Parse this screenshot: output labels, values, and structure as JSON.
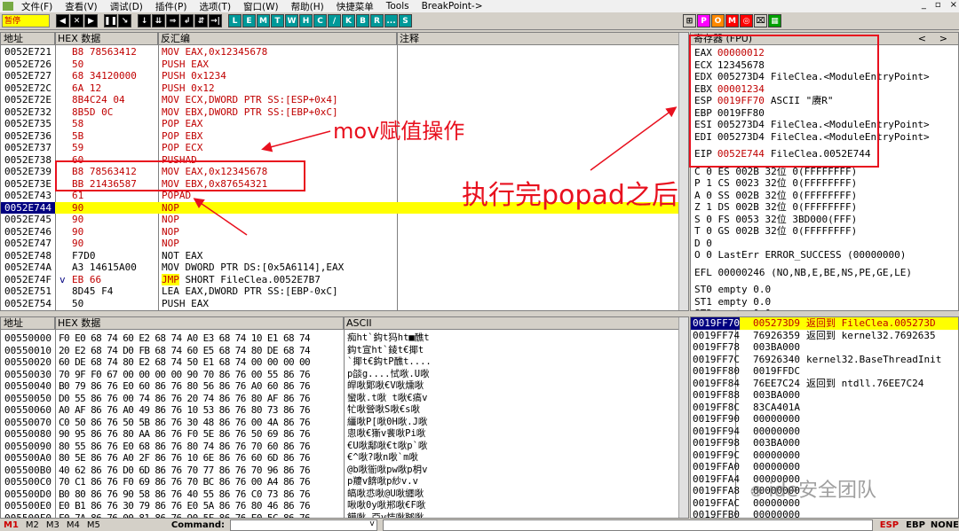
{
  "menu": {
    "items": [
      "文件(F)",
      "查看(V)",
      "调试(D)",
      "插件(P)",
      "选项(T)",
      "窗口(W)",
      "帮助(H)",
      "快捷菜单",
      "Tools",
      "BreakPoint->"
    ],
    "win_buttons": [
      "_",
      "▫",
      "×"
    ]
  },
  "toolbar": {
    "status": "暂停",
    "buttons": [
      "◀",
      "✕",
      "▶",
      "❚❚",
      "↘",
      "↓",
      "⇊",
      "⇒",
      "↲",
      "⇵",
      "→|"
    ],
    "letters": [
      "L",
      "E",
      "M",
      "T",
      "W",
      "H",
      "C",
      "/",
      "K",
      "B",
      "R",
      "...",
      "S"
    ],
    "extra": [
      "⊞",
      "P",
      "O",
      "M",
      "◎",
      "⌧",
      "▦"
    ]
  },
  "disasm": {
    "headers": [
      "地址",
      "HEX 数据",
      "反汇编",
      "注释"
    ],
    "rows": [
      {
        "addr": "0052E721",
        "hex": "B8 78563412",
        "asm": "MOV EAX,0x12345678",
        "mark": "",
        "hl": false
      },
      {
        "addr": "0052E726",
        "hex": "50",
        "asm": "PUSH EAX",
        "mark": "",
        "hl": false
      },
      {
        "addr": "0052E727",
        "hex": "68 34120000",
        "asm": "PUSH 0x1234",
        "mark": "",
        "hl": false
      },
      {
        "addr": "0052E72C",
        "hex": "6A 12",
        "asm": "PUSH 0x12",
        "mark": "",
        "hl": false
      },
      {
        "addr": "0052E72E",
        "hex": "8B4C24 04",
        "asm": "MOV ECX,DWORD PTR SS:[ESP+0x4]",
        "mark": "",
        "hl": false
      },
      {
        "addr": "0052E732",
        "hex": "8B5D 0C",
        "asm": "MOV EBX,DWORD PTR SS:[EBP+0xC]",
        "mark": "",
        "hl": false
      },
      {
        "addr": "0052E735",
        "hex": "58",
        "asm": "POP EAX",
        "mark": "",
        "hl": false
      },
      {
        "addr": "0052E736",
        "hex": "5B",
        "asm": "POP EBX",
        "mark": "",
        "hl": false
      },
      {
        "addr": "0052E737",
        "hex": "59",
        "asm": "POP ECX",
        "mark": "",
        "hl": false
      },
      {
        "addr": "0052E738",
        "hex": "60",
        "asm": "PUSHAD",
        "mark": "",
        "hl": false
      },
      {
        "addr": "0052E739",
        "hex": "B8 78563412",
        "asm": "MOV EAX,0x12345678",
        "mark": "",
        "hl": false
      },
      {
        "addr": "0052E73E",
        "hex": "BB 21436587",
        "asm": "MOV EBX,0x87654321",
        "mark": "",
        "hl": false
      },
      {
        "addr": "0052E743",
        "hex": "61",
        "asm": "POPAD",
        "mark": "",
        "hl": false
      },
      {
        "addr": "0052E744",
        "hex": "90",
        "asm": "NOP",
        "mark": "",
        "hl": true
      },
      {
        "addr": "0052E745",
        "hex": "90",
        "asm": "NOP",
        "mark": "",
        "hl": false
      },
      {
        "addr": "0052E746",
        "hex": "90",
        "asm": "NOP",
        "mark": "",
        "hl": false
      },
      {
        "addr": "0052E747",
        "hex": "90",
        "asm": "NOP",
        "mark": "",
        "hl": false
      },
      {
        "addr": "0052E748",
        "hex": "F7D0",
        "asm": "NOT EAX",
        "mark": "",
        "hl": false
      },
      {
        "addr": "0052E74A",
        "hex": "A3 14615A00",
        "asm": "MOV DWORD PTR DS:[0x5A6114],EAX",
        "mark": "",
        "hl": false
      },
      {
        "addr": "0052E74F",
        "hex": "EB 66",
        "asm": "JMP SHORT FileClea.0052E7B7",
        "mark": "v",
        "hl": false
      },
      {
        "addr": "0052E751",
        "hex": "8D45 F4",
        "asm": "LEA EAX,DWORD PTR SS:[EBP-0xC]",
        "mark": "",
        "hl": false
      },
      {
        "addr": "0052E754",
        "hex": "50",
        "asm": "PUSH EAX",
        "mark": "",
        "hl": false
      }
    ]
  },
  "registers": {
    "header": "寄存器 (FPU)",
    "rows": [
      {
        "name": "EAX",
        "val": "00000012",
        "info": "",
        "red": true
      },
      {
        "name": "ECX",
        "val": "12345678",
        "info": "",
        "red": false
      },
      {
        "name": "EDX",
        "val": "005273D4",
        "info": "FileClea.<ModuleEntryPoint>",
        "red": false
      },
      {
        "name": "EBX",
        "val": "00001234",
        "info": "",
        "red": true
      },
      {
        "name": "ESP",
        "val": "0019FF70",
        "info": "ASCII \"赓R\"",
        "red": true
      },
      {
        "name": "EBP",
        "val": "0019FF80",
        "info": "",
        "red": false
      },
      {
        "name": "ESI",
        "val": "005273D4",
        "info": "FileClea.<ModuleEntryPoint>",
        "red": false
      },
      {
        "name": "EDI",
        "val": "005273D4",
        "info": "FileClea.<ModuleEntryPoint>",
        "red": false
      },
      {
        "name": "EIP",
        "val": "0052E744",
        "info": "FileClea.0052E744",
        "red": true
      }
    ],
    "segs": [
      "C 0  ES 002B 32位 0(FFFFFFFF)",
      "P 1  CS 0023 32位 0(FFFFFFFF)",
      "A 0  SS 002B 32位 0(FFFFFFFF)",
      "Z 1  DS 002B 32位 0(FFFFFFFF)",
      "S 0  FS 0053 32位 3BD000(FFF)",
      "T 0  GS 002B 32位 0(FFFFFFFF)",
      "D 0",
      "O 0  LastErr ERROR_SUCCESS (00000000)"
    ],
    "efl": "EFL 00000246 (NO,NB,E,BE,NS,PE,GE,LE)",
    "fpu": [
      "ST0 empty 0.0",
      "ST1 empty 0.0",
      "ST2 empty 0.0"
    ]
  },
  "dump": {
    "headers": [
      "地址",
      "HEX 数据",
      "ASCII"
    ],
    "rows": [
      {
        "addr": "00550000",
        "hex": "F0 E0 68 74 60 E2 68 74 A0 E3 68 74 10 E1 68 74",
        "ascii": "痴ht`鈎t犸ht■醮t"
      },
      {
        "addr": "00550010",
        "hex": "20 E2 68 74 D0 FB 68 74 60 E5 68 74 80 DE 68 74",
        "ascii": " 鈎t宣ht`錂t€揶t"
      },
      {
        "addr": "00550020",
        "hex": "60 DE 68 74 80 E2 68 74 50 E1 68 74 00 00 00 00",
        "ascii": "`揶t€鈎tP醮t...."
      },
      {
        "addr": "00550030",
        "hex": "70 9F F0 67 00 00 00 00 90 70 86 76 00 55 86 76",
        "ascii": "p燄g....恜唙.U唙"
      },
      {
        "addr": "00550040",
        "hex": "B0 79 86 76 E0 60 86 76 80 56 86 76 A0 60 86 76",
        "ascii": "皔唙郹唙€V唙燻唙"
      },
      {
        "addr": "00550050",
        "hex": "D0 55 86 76 00 74 86 76 20 74 86 76 80 AF 86 76",
        "ascii": "蠻唙.t唙 t唙€瘑v"
      },
      {
        "addr": "00550060",
        "hex": "A0 AF 86 76 A0 49 86 76 10 53 86 76 80 73 86 76",
        "ascii": "牤唙營唙S唙€s唙"
      },
      {
        "addr": "00550070",
        "hex": "C0 50 86 76 50 5B 86 76 30 48 86 76 00 4A 86 76",
        "ascii": "繮唙P[唙0H唙.J唙"
      },
      {
        "addr": "00550080",
        "hex": "90 95 86 76 80 AA 86 76 F0 5E 86 76 50 69 86 76",
        "ascii": "悤唙€獑v餥唙Pi唙"
      },
      {
        "addr": "00550090",
        "hex": "80 55 86 76 E0 68 86 76 80 74 86 76 70 60 86 76",
        "ascii": "€U唙鄅唙€t唙p`唙"
      },
      {
        "addr": "005500A0",
        "hex": "80 5E 86 76 A0 2F 86 76 10 6E 86 76 60 6D 86 76",
        "ascii": "€^唙?唙n唙`m唙"
      },
      {
        "addr": "005500B0",
        "hex": "40 62 86 76 D0 6D 86 76 70 77 86 76 70 96 86 76",
        "ascii": "@b唙衜唙pw唙p枂v"
      },
      {
        "addr": "005500C0",
        "hex": "70 C1 86 76 F0 69 86 76 70 BC 86 76 00 A4 86 76",
        "ascii": "p羻v餴唙p紗v.v"
      },
      {
        "addr": "005500D0",
        "hex": "B0 80 86 76 90 58 86 76 40 55 86 76 C0 73 86 76",
        "ascii": "皜唙怷唙@U唙纒唙"
      },
      {
        "addr": "005500E0",
        "hex": "E0 B1 86 76 30 79 86 76 E0 5A 86 76 80 46 86 76",
        "ascii": "啾唙0y唙郱唙€F唙"
      },
      {
        "addr": "005500F0",
        "hex": "F0 7A 86 76 00 81 86 76 90 5F 86 76 E0 5C 86 76",
        "ascii": "饃唙.亞v恄唙郰唙"
      }
    ]
  },
  "stack": {
    "rows": [
      {
        "addr": "0019FF70",
        "val": "005273D9",
        "info": "返回到 FileClea.005273D",
        "sel": true
      },
      {
        "addr": "0019FF74",
        "val": "76926359",
        "info": "返回到 kernel32.7692635",
        "sel": false
      },
      {
        "addr": "0019FF78",
        "val": "003BA000",
        "info": "",
        "sel": false
      },
      {
        "addr": "0019FF7C",
        "val": "76926340",
        "info": "kernel32.BaseThreadInit",
        "sel": false
      },
      {
        "addr": "0019FF80",
        "val": "0019FFDC",
        "info": "",
        "sel": false
      },
      {
        "addr": "0019FF84",
        "val": "76EE7C24",
        "info": "返回到 ntdll.76EE7C24",
        "sel": false
      },
      {
        "addr": "0019FF88",
        "val": "003BA000",
        "info": "",
        "sel": false
      },
      {
        "addr": "0019FF8C",
        "val": "83CA401A",
        "info": "",
        "sel": false
      },
      {
        "addr": "0019FF90",
        "val": "00000000",
        "info": "",
        "sel": false
      },
      {
        "addr": "0019FF94",
        "val": "00000000",
        "info": "",
        "sel": false
      },
      {
        "addr": "0019FF98",
        "val": "003BA000",
        "info": "",
        "sel": false
      },
      {
        "addr": "0019FF9C",
        "val": "00000000",
        "info": "",
        "sel": false
      },
      {
        "addr": "0019FFA0",
        "val": "00000000",
        "info": "",
        "sel": false
      },
      {
        "addr": "0019FFA4",
        "val": "00000000",
        "info": "",
        "sel": false
      },
      {
        "addr": "0019FFA8",
        "val": "00000000",
        "info": "",
        "sel": false
      },
      {
        "addr": "0019FFAC",
        "val": "00000000",
        "info": "",
        "sel": false
      },
      {
        "addr": "0019FFB0",
        "val": "00000000",
        "info": "",
        "sel": false
      }
    ]
  },
  "annotations": {
    "mov": "mov赋值操作",
    "popad": "执行完popad之后"
  },
  "watermark": "ide安全团队",
  "statusbar": {
    "tabs": [
      "M1",
      "M2",
      "M3",
      "M4",
      "M5"
    ],
    "command_label": "Command:",
    "right": [
      "ESP",
      "EBP",
      "NONE"
    ]
  },
  "colors": {
    "accent_red": "#e8101e",
    "highlight": "#ffff00",
    "selected": "#000080"
  }
}
